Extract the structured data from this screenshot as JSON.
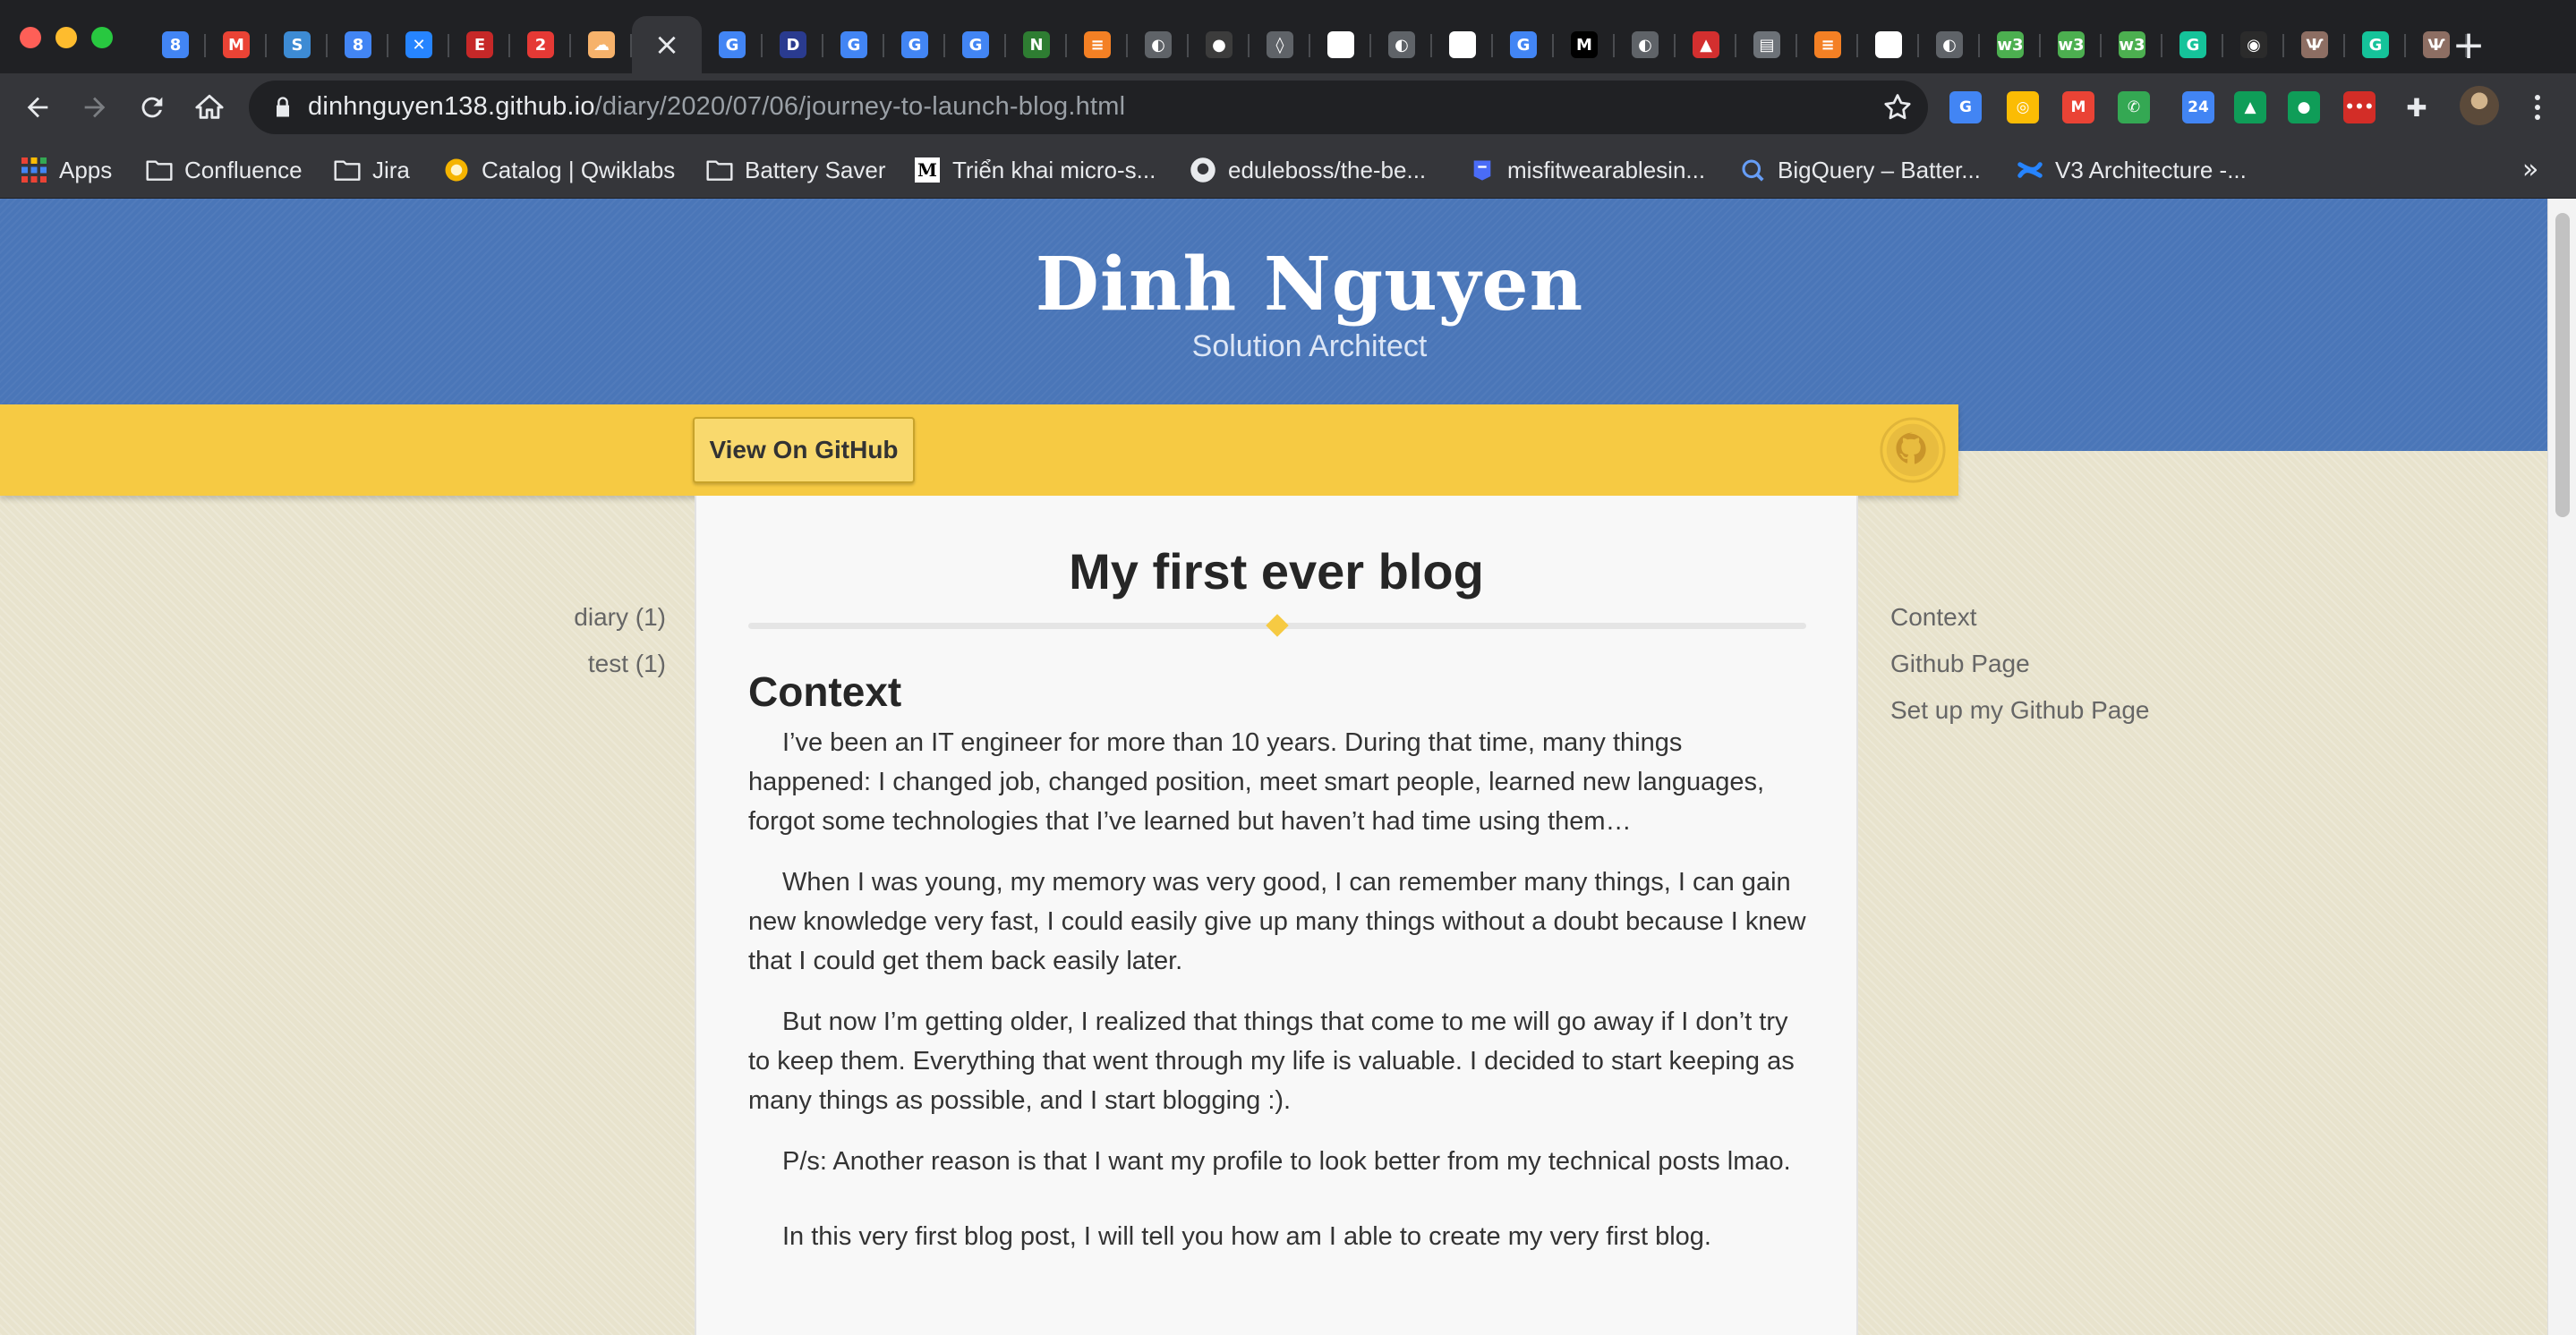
{
  "browser": {
    "tabs": [
      {
        "icon": "calendar-icon",
        "glyph": "8",
        "color": "#4285f4"
      },
      {
        "icon": "gmail-icon",
        "glyph": "M",
        "color": "#ea4335"
      },
      {
        "icon": "swirl-icon",
        "glyph": "S",
        "color": "#3d8bd4"
      },
      {
        "icon": "calendar-icon",
        "glyph": "8",
        "color": "#4285f4"
      },
      {
        "icon": "confluence-icon",
        "glyph": "✕",
        "color": "#2684ff"
      },
      {
        "icon": "document-icon",
        "glyph": "E",
        "color": "#c62828"
      },
      {
        "icon": "notification-icon",
        "glyph": "2",
        "color": "#e53935"
      },
      {
        "icon": "cloud-icon",
        "glyph": "☁",
        "color": "#f6b26b"
      },
      {
        "icon": "close-icon",
        "glyph": "×",
        "color": "",
        "active": true
      },
      {
        "icon": "google-icon",
        "glyph": "G",
        "color": "#4285f4"
      },
      {
        "icon": "dans-dolls-icon",
        "glyph": "D",
        "color": "#2a3b8f"
      },
      {
        "icon": "google-icon",
        "glyph": "G",
        "color": "#4285f4"
      },
      {
        "icon": "google-icon",
        "glyph": "G",
        "color": "#4285f4"
      },
      {
        "icon": "google-icon",
        "glyph": "G",
        "color": "#4285f4"
      },
      {
        "icon": "n-icon",
        "glyph": "N",
        "color": "#2e7d32"
      },
      {
        "icon": "stackoverflow-icon",
        "glyph": "≡",
        "color": "#f48024"
      },
      {
        "icon": "globe-icon",
        "glyph": "◐",
        "color": "#5f6368"
      },
      {
        "icon": "dark-avatar-icon",
        "glyph": "●",
        "color": "#3c3c3c"
      },
      {
        "icon": "drop-icon",
        "glyph": "◊",
        "color": "#5f6368"
      },
      {
        "icon": "github-icon",
        "glyph": "◉",
        "color": "#ffffff"
      },
      {
        "icon": "globe-icon",
        "glyph": "◐",
        "color": "#5f6368"
      },
      {
        "icon": "github-icon",
        "glyph": "◉",
        "color": "#ffffff"
      },
      {
        "icon": "google-icon",
        "glyph": "G",
        "color": "#4285f4"
      },
      {
        "icon": "medium-icon",
        "glyph": "M",
        "color": "#000000"
      },
      {
        "icon": "globe-icon",
        "glyph": "◐",
        "color": "#5f6368"
      },
      {
        "icon": "red-house-icon",
        "glyph": "▲",
        "color": "#d32f2f"
      },
      {
        "icon": "server-icon",
        "glyph": "▤",
        "color": "#6d7278"
      },
      {
        "icon": "stackoverflow-icon",
        "glyph": "≡",
        "color": "#f48024"
      },
      {
        "icon": "github-icon",
        "glyph": "◉",
        "color": "#ffffff"
      },
      {
        "icon": "globe-icon",
        "glyph": "◐",
        "color": "#5f6368"
      },
      {
        "icon": "w3schools-icon",
        "glyph": "w3",
        "color": "#4caf50"
      },
      {
        "icon": "w3schools-icon",
        "glyph": "w3",
        "color": "#4caf50"
      },
      {
        "icon": "w3schools-icon",
        "glyph": "w3",
        "color": "#4caf50"
      },
      {
        "icon": "grammarly-icon",
        "glyph": "G",
        "color": "#15c39a"
      },
      {
        "icon": "github-icon",
        "glyph": "◉",
        "color": "#2b2b2b"
      },
      {
        "icon": "owl-icon",
        "glyph": "Ѱ",
        "color": "#8d6e63"
      },
      {
        "icon": "grammarly-icon",
        "glyph": "G",
        "color": "#15c39a"
      },
      {
        "icon": "owl-icon",
        "glyph": "Ѱ",
        "color": "#8d6e63"
      }
    ],
    "address": {
      "host": "dinhnguyen138.github.io",
      "path": "/diary/2020/07/06/journey-to-launch-blog.html"
    },
    "extensions": [
      {
        "icon": "google-translate-icon",
        "glyph": "G",
        "color": "#4285f4"
      },
      {
        "icon": "compass-icon",
        "glyph": "◎",
        "color": "#fbbc04"
      },
      {
        "icon": "gmail-notifier-icon",
        "glyph": "M",
        "color": "#ea4335"
      },
      {
        "icon": "phone-icon",
        "glyph": "✆",
        "color": "#34a853"
      },
      {
        "icon": "calendar-24-icon",
        "glyph": "24",
        "color": "#4285f4"
      },
      {
        "icon": "google-drive-icon",
        "glyph": "▲",
        "color": "#0f9d58"
      },
      {
        "icon": "speech-bubble-icon",
        "glyph": "●",
        "color": "#0f9d58"
      },
      {
        "icon": "lastpass-icon",
        "glyph": "•••",
        "color": "#d32d27"
      },
      {
        "icon": "puzzle-icon",
        "glyph": "✚",
        "color": "#e8eaed"
      }
    ],
    "bookmarks": [
      {
        "label": "Apps",
        "icon": "apps-grid-icon"
      },
      {
        "label": "Confluence",
        "icon": "folder-icon"
      },
      {
        "label": "Jira",
        "icon": "folder-icon"
      },
      {
        "label": "Catalog | Qwiklabs",
        "icon": "qwiklabs-icon"
      },
      {
        "label": "Battery Saver",
        "icon": "folder-icon"
      },
      {
        "label": "Triển khai micro-s...",
        "icon": "medium-icon"
      },
      {
        "label": "eduleboss/the-be...",
        "icon": "github-icon"
      },
      {
        "label": "misfitwearablesin...",
        "icon": "misfit-icon"
      },
      {
        "label": "BigQuery – Batter...",
        "icon": "bigquery-icon"
      },
      {
        "label": "V3 Architecture -...",
        "icon": "confluence-icon"
      }
    ],
    "more_bookmarks": "»"
  },
  "site": {
    "title": "Dinh Nguyen",
    "subtitle": "Solution Architect",
    "github_button": "View On GitHub"
  },
  "post": {
    "title": "My first ever blog",
    "section_heading": "Context",
    "paragraphs": [
      "I’ve been an IT engineer for more than 10 years. During that time, many things happened: I changed job, changed position, meet smart people, learned new languages, forgot some technologies that I’ve learned but haven’t had time using them…",
      "When I was young, my memory was very good, I can remember many things, I can gain new knowledge very fast, I could easily give up many things without a doubt because I knew that I could get them back easily later.",
      "But now I’m getting older, I realized that things that come to me will go away if I don’t try to keep them. Everything that went through my life is valuable. I decided to start keeping as many things as possible, and I start blogging :).",
      "P/s: Another reason is that I want my profile to look better from my technical posts lmao.",
      "In this very first blog post, I will tell you how am I able to create my very first blog."
    ]
  },
  "sidebar_left": {
    "tags": [
      "diary (1)",
      "test (1)"
    ]
  },
  "sidebar_right": {
    "toc": [
      "Context",
      "Github Page",
      "Set up my Github Page"
    ]
  },
  "colors": {
    "header_blue": "#4a76b8",
    "banner_yellow": "#f6ca43",
    "background_beige": "#e8e3cd"
  }
}
